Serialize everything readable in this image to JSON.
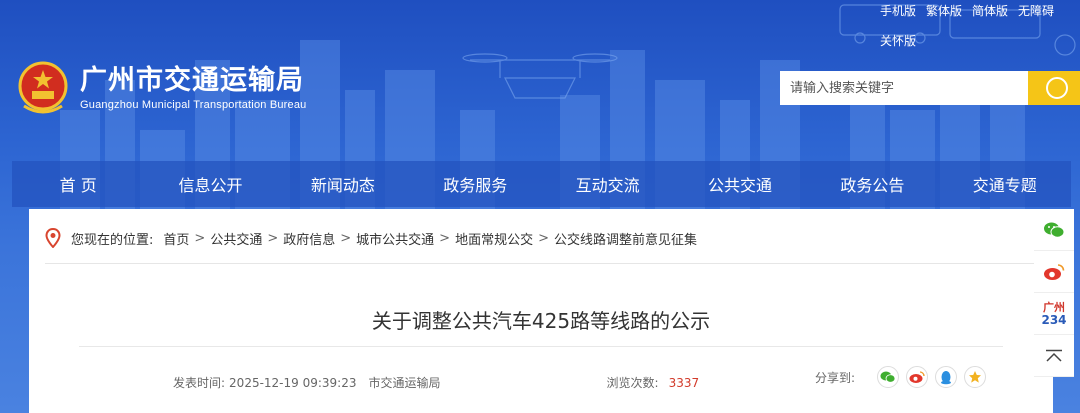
{
  "header": {
    "top_links": [
      "手机版",
      "繁体版",
      "简体版",
      "无障碍"
    ],
    "elder_link": "关怀版",
    "title_cn": "广州市交通运输局",
    "title_en": "Guangzhou Municipal Transportation Bureau",
    "search_placeholder": "请输入搜索关键字"
  },
  "nav": [
    "首 页",
    "信息公开",
    "新闻动态",
    "政务服务",
    "互动交流",
    "公共交通",
    "政务公告",
    "交通专题"
  ],
  "breadcrumb": {
    "prefix": "您现在的位置:",
    "items": [
      "首页",
      "公共交通",
      "政府信息",
      "城市公共交通",
      "地面常规公交",
      "公交线路调整前意见征集"
    ]
  },
  "article": {
    "title": "关于调整公共汽车425路等线路的公示",
    "publish_label": "发表时间:",
    "publish_time": "2025-12-19 09:39:23",
    "source": "市交通运输局",
    "views_label": "浏览次数:",
    "views": "3337",
    "share_label": "分享到:"
  },
  "sidebar": {
    "gz_top": "广州",
    "gz_bottom": "234"
  },
  "colors": {
    "banner": "#2d65d2",
    "search_button": "#f5c517",
    "views": "#d23a2a"
  }
}
